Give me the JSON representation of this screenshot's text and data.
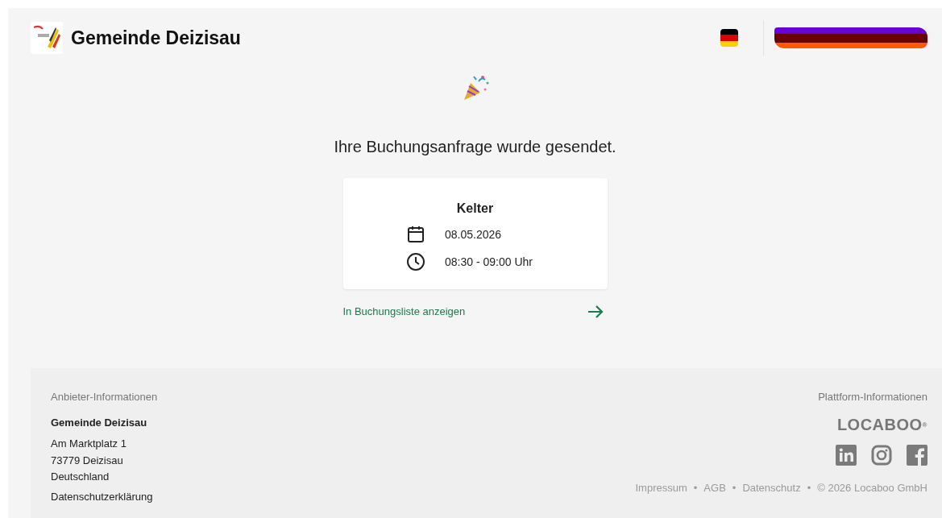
{
  "header": {
    "title": "Gemeinde Deizisau",
    "language_flag": {
      "stripes": [
        {
          "color": "#000000"
        },
        {
          "color": "#dd0000"
        },
        {
          "color": "#ffce00"
        }
      ]
    }
  },
  "confirmation": {
    "message": "Ihre Buchungsanfrage wurde gesendet.",
    "resource": "Kelter",
    "date": "08.05.2026",
    "time": "08:30 - 09:00 Uhr",
    "link": "In Buchungsliste anzeigen"
  },
  "footer": {
    "provider_heading": "Anbieter-Informationen",
    "provider_name": "Gemeinde Deizisau",
    "address": [
      "Am Marktplatz 1",
      "73779 Deizisau",
      "Deutschland"
    ],
    "privacy_link": "Datenschutzerklärung",
    "platform_heading": "Plattform-Informationen",
    "platform_logo": "LOCABOO",
    "logo_mark": "®",
    "social": [
      {
        "kind": "linkedin"
      },
      {
        "kind": "instagram"
      },
      {
        "kind": "facebook"
      }
    ],
    "links": [
      "Impressum",
      "AGB",
      "Datenschutz"
    ],
    "separator": "•",
    "copyright": "© 2026 Locaboo GmbH"
  }
}
